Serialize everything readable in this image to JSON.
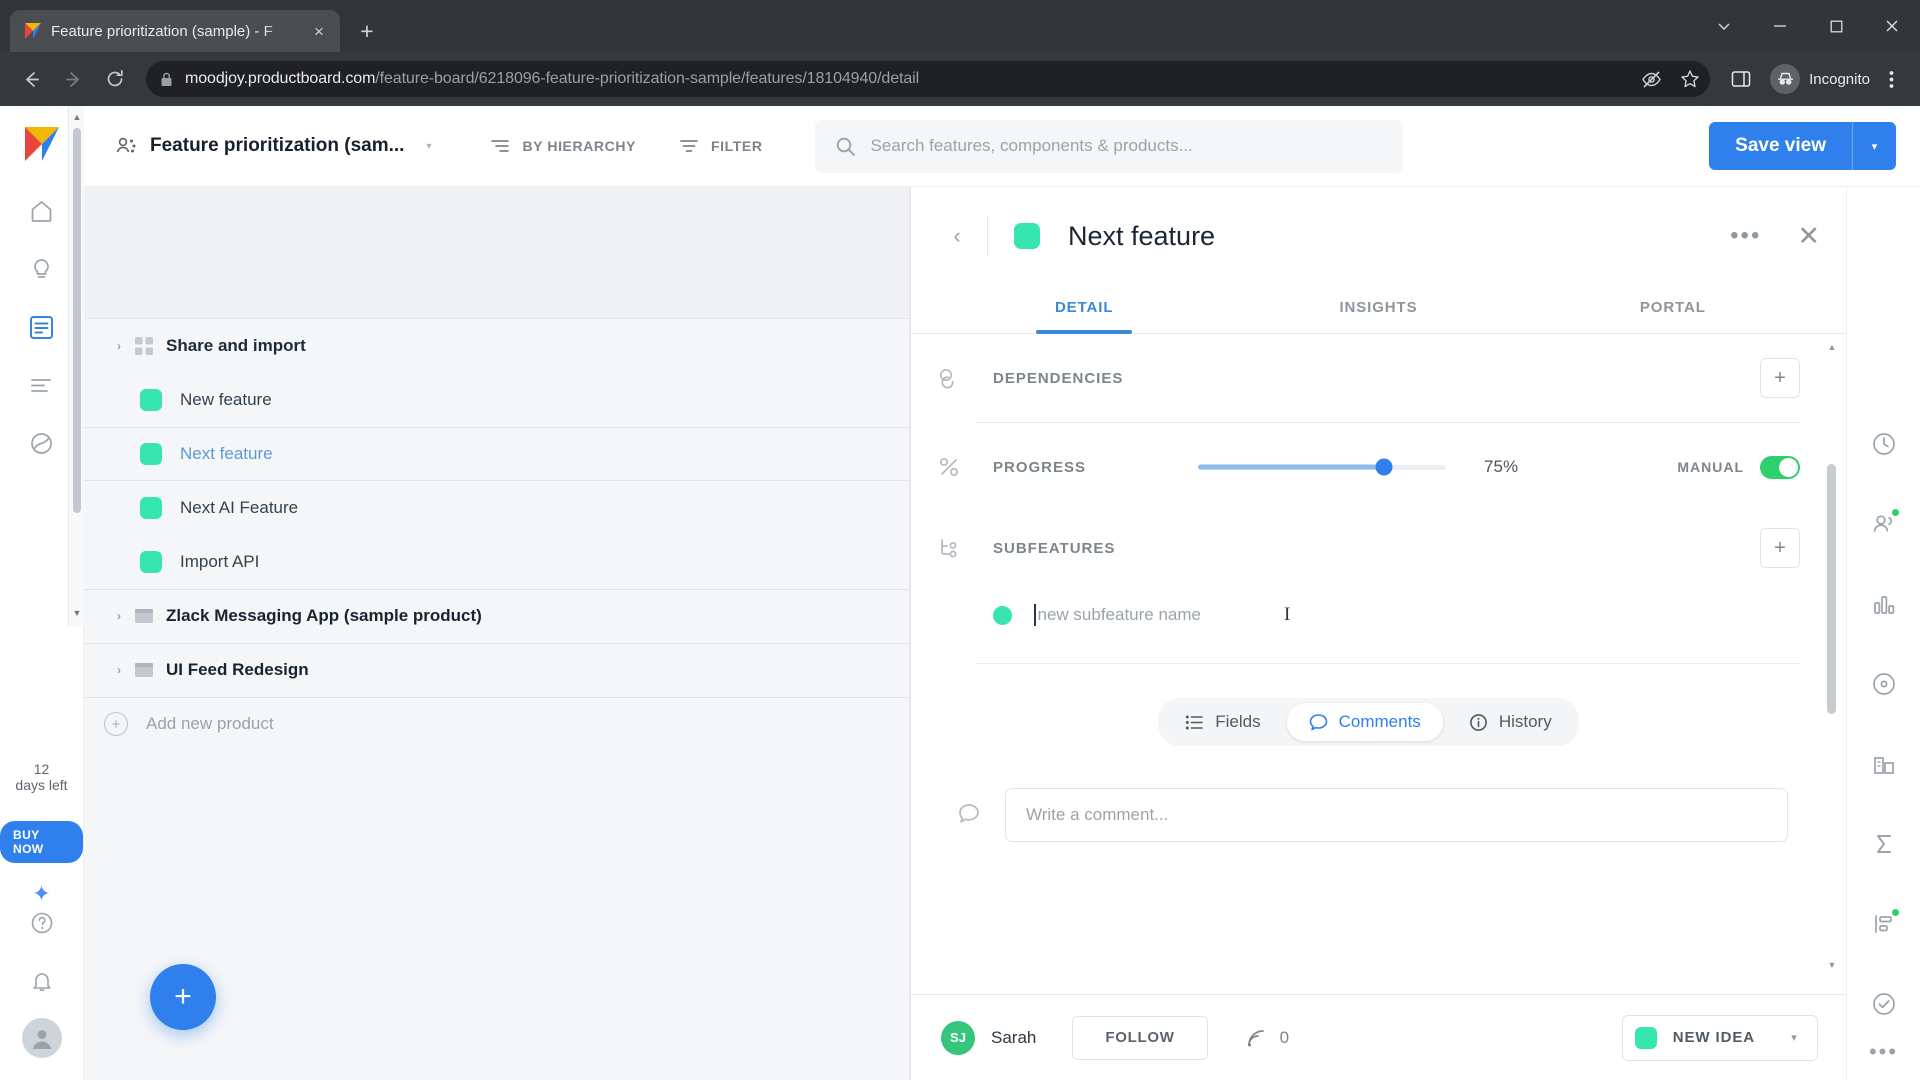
{
  "browser": {
    "tab": {
      "title": "Feature prioritization (sample) - F",
      "favicon": "productboard-logo-icon",
      "close": "×"
    },
    "newtab_label": "+",
    "window_controls": {
      "minimize": "–",
      "maximize": "□",
      "close": "✕",
      "more": "⌄"
    },
    "nav": {
      "back": "←",
      "forward": "→",
      "reload": "⟳"
    },
    "url": {
      "domain": "moodjoy.productboard.com",
      "path": "/feature-board/6218096-feature-prioritization-sample/features/18104940/detail",
      "lock_icon": "lock-icon"
    },
    "toolbar": {
      "profile_label": "Incognito",
      "bookmark_icon": "star-icon",
      "panel_icon": "side-panel-icon",
      "tracking_icon": "no-tracking-icon",
      "menu_icon": "kebab-menu-icon"
    }
  },
  "rail": {
    "logo": "productboard-logo",
    "items": [
      {
        "name": "home-icon",
        "active": false
      },
      {
        "name": "insights-icon",
        "active": false
      },
      {
        "name": "features-icon",
        "active": true
      },
      {
        "name": "roadmap-icon",
        "active": false
      },
      {
        "name": "portal-icon",
        "active": false
      }
    ],
    "trial_days": "12",
    "trial_label": "days left",
    "buy_now": "BUY NOW",
    "sparkle_icon": "ai-sparkle-icon",
    "help_icon": "help-circle-icon",
    "bell_icon": "notification-bell-icon",
    "avatar": "user-avatar"
  },
  "apptop": {
    "board_name": "Feature prioritization (sam...",
    "board_icon": "board-users-icon",
    "caret": "▾",
    "hierarchy_label": "BY HIERARCHY",
    "filter_label": "FILTER",
    "search_placeholder": "Search features, components & products...",
    "save_view_label": "Save view",
    "save_view_caret": "▾"
  },
  "list": {
    "rows": [
      {
        "label": "Share and import",
        "type": "group",
        "icon": "grid-icon",
        "chevron": "›",
        "selected": false
      },
      {
        "label": "New feature",
        "type": "feature",
        "swatch": "#37e5ae",
        "selected": false
      },
      {
        "label": "Next feature",
        "type": "feature",
        "swatch": "#37e5ae",
        "selected": true
      },
      {
        "label": "Next AI Feature",
        "type": "feature",
        "swatch": "#37e5ae",
        "selected": false
      },
      {
        "label": "Import API",
        "type": "feature",
        "swatch": "#37e5ae",
        "selected": false
      },
      {
        "label": "Zlack Messaging App (sample product)",
        "type": "product",
        "icon": "product-icon",
        "chevron": "›",
        "selected": false
      },
      {
        "label": "UI Feed Redesign",
        "type": "product",
        "icon": "product-icon",
        "chevron": "›",
        "selected": false
      },
      {
        "label": "Add new product",
        "type": "add",
        "icon": "plus-circle-icon",
        "selected": false
      }
    ],
    "fab_label": "+"
  },
  "detail": {
    "back_icon": "‹",
    "title": "Next feature",
    "swatch": "#37e5ae",
    "more_icon": "•••",
    "close_icon": "✕",
    "tabs": [
      {
        "label": "DETAIL",
        "active": true
      },
      {
        "label": "INSIGHTS",
        "active": false
      },
      {
        "label": "PORTAL",
        "active": false
      }
    ],
    "dependencies": {
      "label": "DEPENDENCIES",
      "icon": "dependencies-icon",
      "add": "+"
    },
    "progress": {
      "label": "PROGRESS",
      "icon": "percent-icon",
      "value": 75,
      "value_text": "75%",
      "manual_label": "MANUAL",
      "manual_on": true,
      "fill_color": "#8ebdf0",
      "knob_color": "#2f80ed"
    },
    "subfeatures": {
      "label": "SUBFEATURES",
      "icon": "subfeatures-icon",
      "add": "+",
      "input_placeholder": "new subfeature name",
      "input_value": "",
      "dot_color": "#37e5ae"
    },
    "segmented": [
      {
        "label": "Fields",
        "icon": "list-icon",
        "active": false
      },
      {
        "label": "Comments",
        "icon": "comment-bubble-icon",
        "active": true
      },
      {
        "label": "History",
        "icon": "info-circle-icon",
        "active": false
      }
    ],
    "comment": {
      "icon": "comment-icon",
      "placeholder": "Write a comment...",
      "value": ""
    },
    "footer": {
      "avatar_initials": "SJ",
      "user_name": "Sarah",
      "follow_label": "FOLLOW",
      "votes_icon": "votes-icon",
      "votes_count": "0",
      "status_swatch": "#37e5ae",
      "status_label": "NEW IDEA",
      "status_caret": "▾"
    }
  },
  "right_rail": {
    "items": [
      {
        "name": "history-clock-icon",
        "badge": false
      },
      {
        "name": "users-insights-icon",
        "badge": true
      },
      {
        "name": "chart-bars-icon",
        "badge": false
      },
      {
        "name": "target-circle-icon",
        "badge": false
      },
      {
        "name": "company-icon",
        "badge": false
      },
      {
        "name": "sigma-icon",
        "badge": false
      },
      {
        "name": "roadmap-lane-icon",
        "badge": true
      },
      {
        "name": "check-circle-icon",
        "badge": false
      }
    ],
    "more": "•••"
  },
  "colors": {
    "accent_blue": "#2f80ed",
    "teal": "#37e5ae",
    "green_toggle": "#2dd06e"
  }
}
